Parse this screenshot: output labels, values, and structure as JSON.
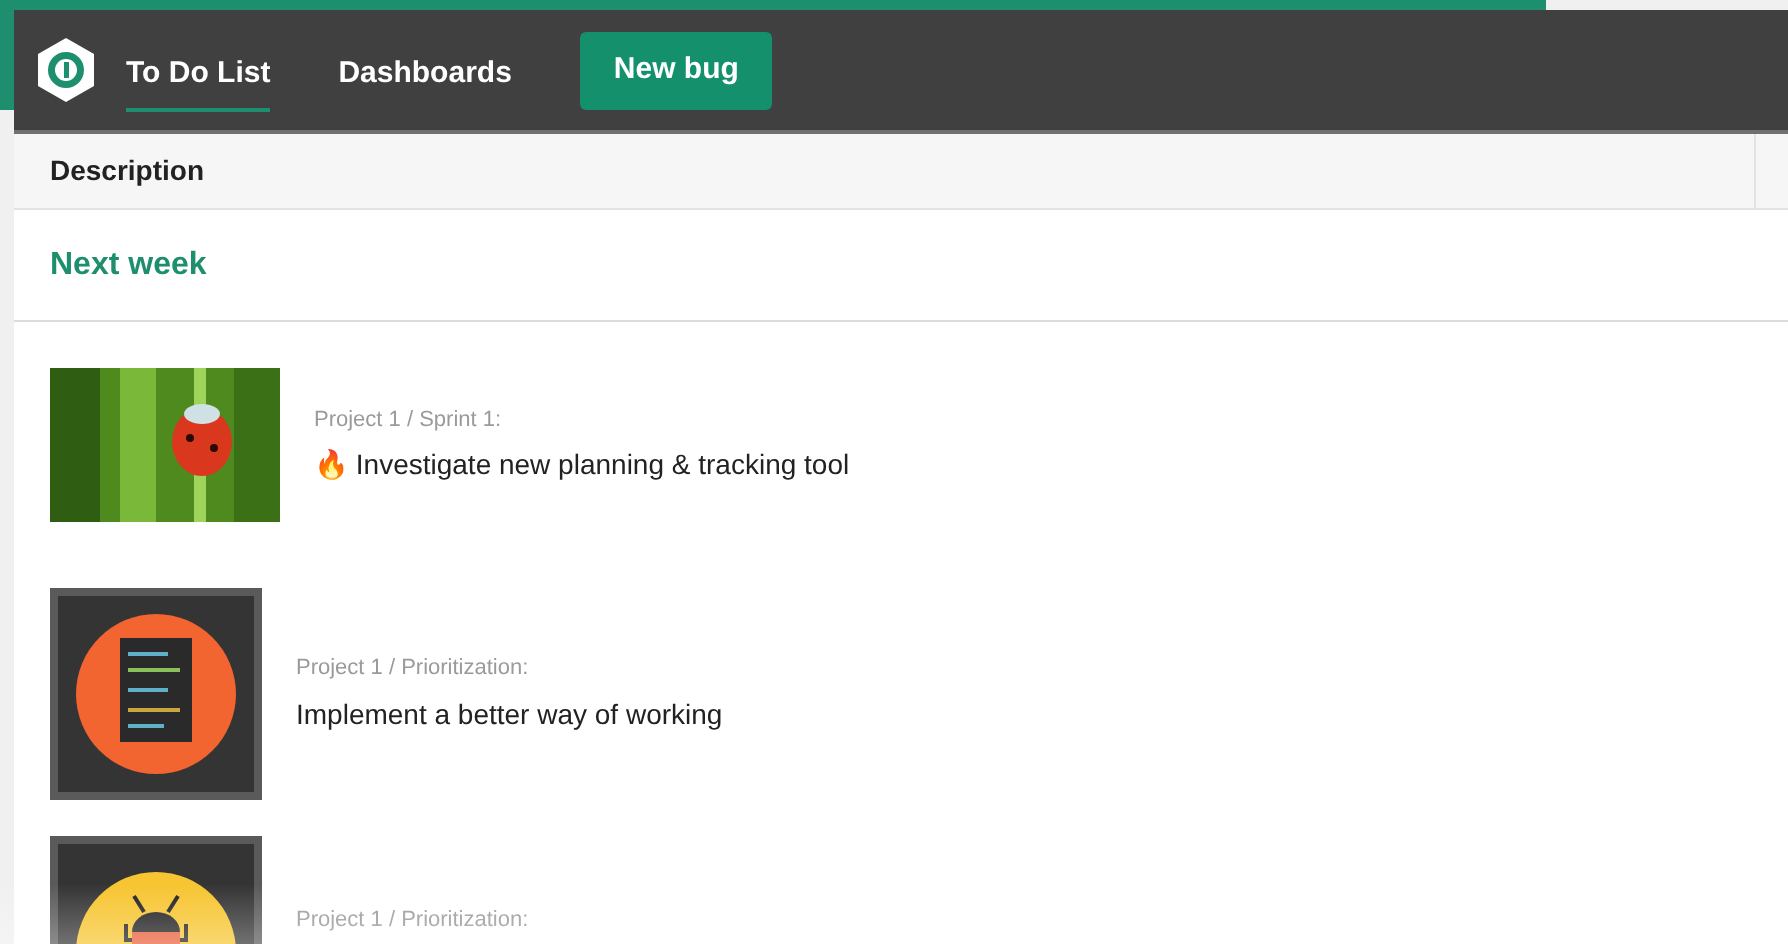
{
  "nav": {
    "tabs": [
      {
        "label": "To Do List",
        "selected": true
      },
      {
        "label": "Dashboards",
        "selected": false
      }
    ],
    "action": "New bug"
  },
  "table": {
    "columns": [
      "Description"
    ]
  },
  "group": {
    "title": "Next week"
  },
  "items": [
    {
      "kind": "picture",
      "path": "Project 1 / Sprint 1:",
      "title": "🔥 Investigate new planning & tracking tool"
    },
    {
      "kind": "document",
      "path": "Project 1 / Prioritization:",
      "title": "Implement a better way of working"
    },
    {
      "kind": "bug",
      "path": "Project 1 / Prioritization:"
    }
  ]
}
